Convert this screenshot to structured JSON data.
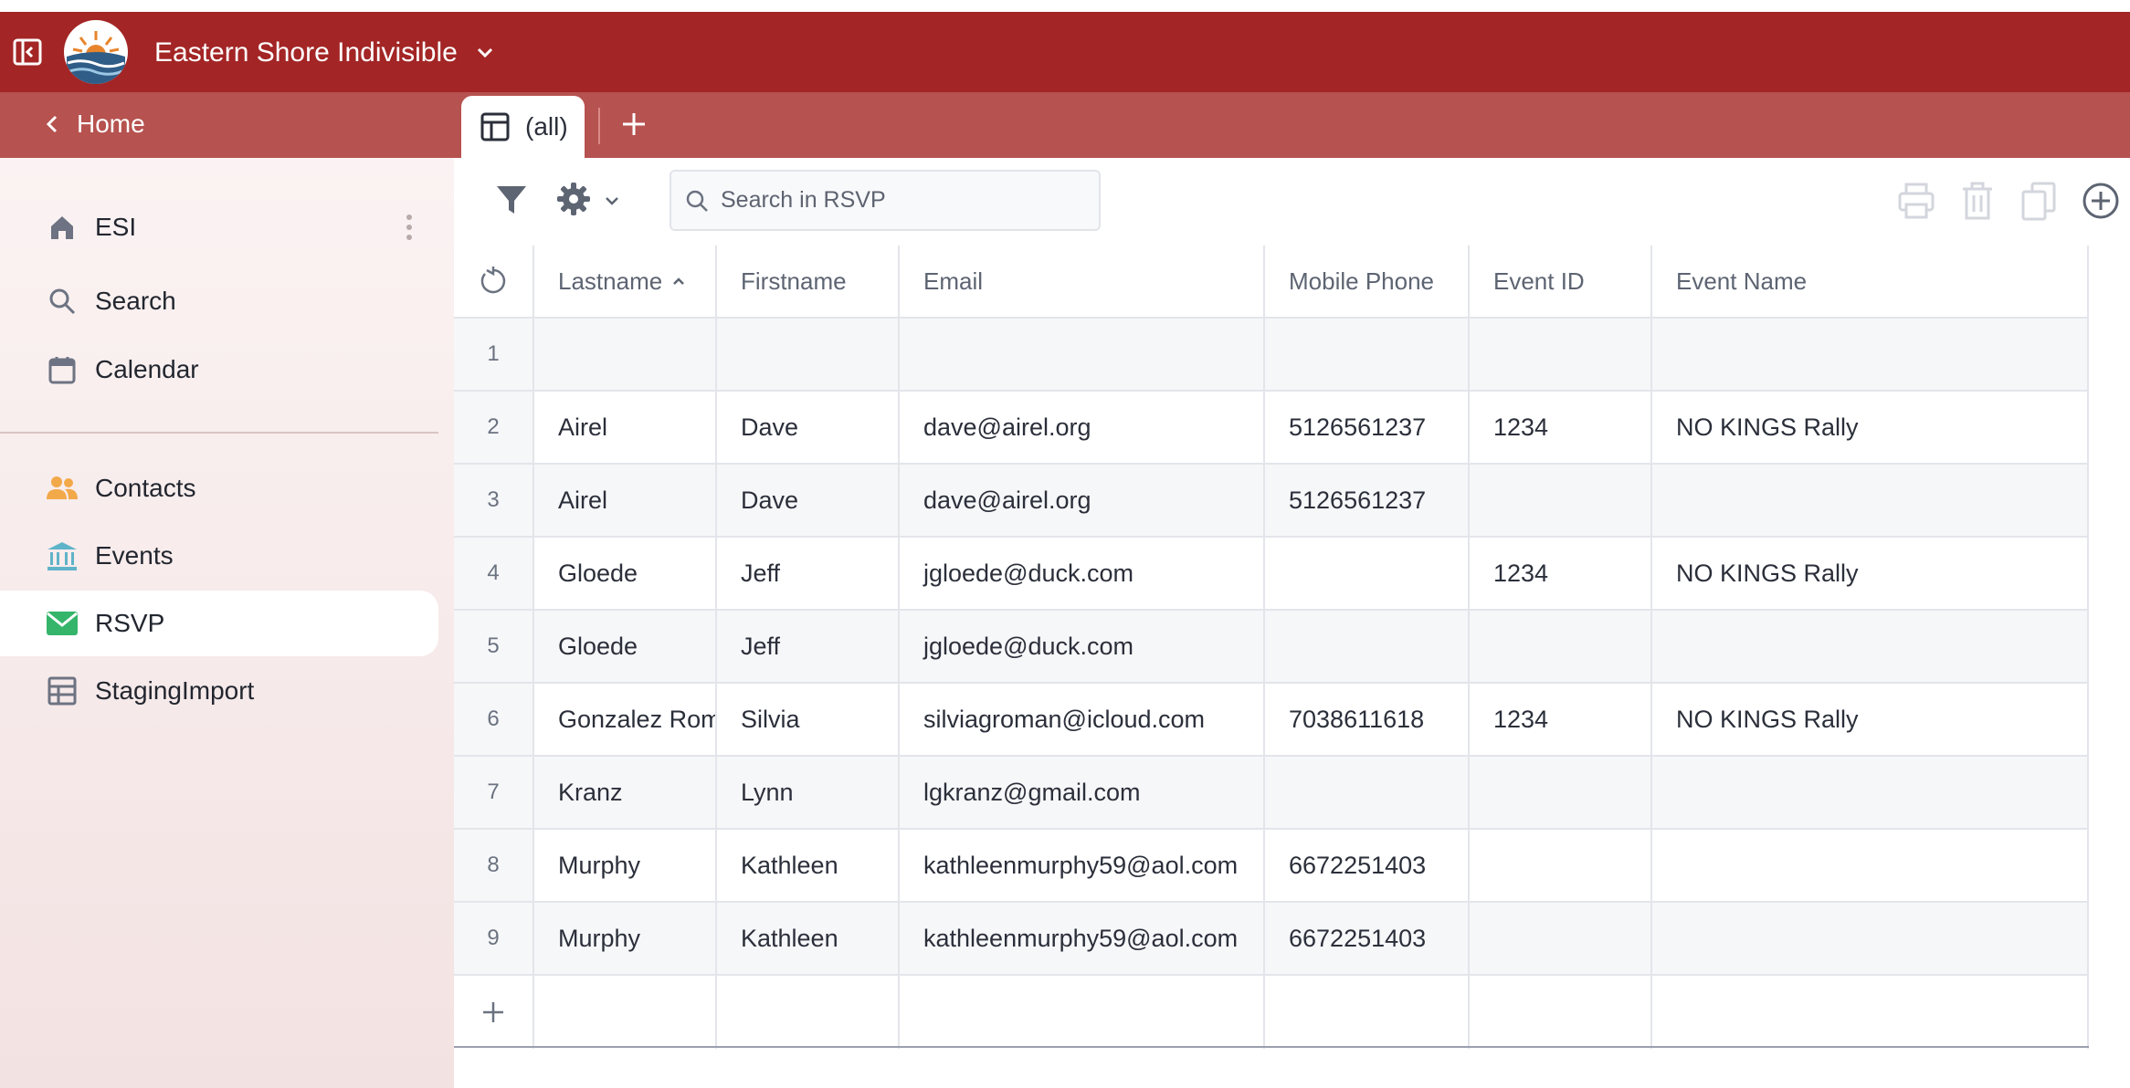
{
  "header": {
    "org_name": "Eastern Shore Indivisible",
    "brand_color": "#a32525",
    "icons": [
      "sidebar-toggle-icon",
      "logo",
      "chevron-down-icon"
    ]
  },
  "subbar": {
    "home_label": "Home",
    "tab_label": "(all)",
    "tab_icon": "table-icon",
    "add_tab_icon": "plus-icon"
  },
  "sidebar": {
    "items": [
      {
        "label": "ESI",
        "icon": "home-icon"
      },
      {
        "label": "Search",
        "icon": "search-icon"
      },
      {
        "label": "Calendar",
        "icon": "calendar-icon"
      },
      {
        "label": "Contacts",
        "icon": "people-icon"
      },
      {
        "label": "Events",
        "icon": "bank-icon"
      },
      {
        "label": "RSVP",
        "icon": "mail-icon"
      },
      {
        "label": "StagingImport",
        "icon": "table-icon"
      }
    ],
    "active": "RSVP"
  },
  "toolbar": {
    "search_placeholder": "Search in RSVP",
    "icons": [
      "filter-icon",
      "gear-icon",
      "print-icon",
      "trash-icon",
      "copy-icon",
      "add-circle-icon"
    ]
  },
  "grid": {
    "columns": [
      "Lastname",
      "Firstname",
      "Email",
      "Mobile Phone",
      "Event ID",
      "Event Name"
    ],
    "sorted_column": "Lastname",
    "sort_direction": "ascending",
    "rows": [
      {
        "n": "1",
        "last": "",
        "first": "",
        "email": "",
        "phone": "",
        "event_id": "",
        "event_name": ""
      },
      {
        "n": "2",
        "last": "Airel",
        "first": "Dave",
        "email": "dave@airel.org",
        "phone": "5126561237",
        "event_id": "1234",
        "event_name": "NO KINGS Rally"
      },
      {
        "n": "3",
        "last": "Airel",
        "first": "Dave",
        "email": "dave@airel.org",
        "phone": "5126561237",
        "event_id": "",
        "event_name": ""
      },
      {
        "n": "4",
        "last": "Gloede",
        "first": "Jeff",
        "email": "jgloede@duck.com",
        "phone": "",
        "event_id": "1234",
        "event_name": "NO KINGS Rally"
      },
      {
        "n": "5",
        "last": "Gloede",
        "first": "Jeff",
        "email": "jgloede@duck.com",
        "phone": "",
        "event_id": "",
        "event_name": ""
      },
      {
        "n": "6",
        "last": "Gonzalez Rom",
        "first": "Silvia",
        "email": "silviagroman@icloud.com",
        "phone": "7038611618",
        "event_id": "1234",
        "event_name": "NO KINGS Rally"
      },
      {
        "n": "7",
        "last": "Kranz",
        "first": "Lynn",
        "email": "lgkranz@gmail.com",
        "phone": "",
        "event_id": "",
        "event_name": ""
      },
      {
        "n": "8",
        "last": "Murphy",
        "first": "Kathleen",
        "email": "kathleenmurphy59@aol.com",
        "phone": "6672251403",
        "event_id": "",
        "event_name": ""
      },
      {
        "n": "9",
        "last": "Murphy",
        "first": "Kathleen",
        "email": "kathleenmurphy59@aol.com",
        "phone": "6672251403",
        "event_id": "",
        "event_name": ""
      }
    ]
  }
}
